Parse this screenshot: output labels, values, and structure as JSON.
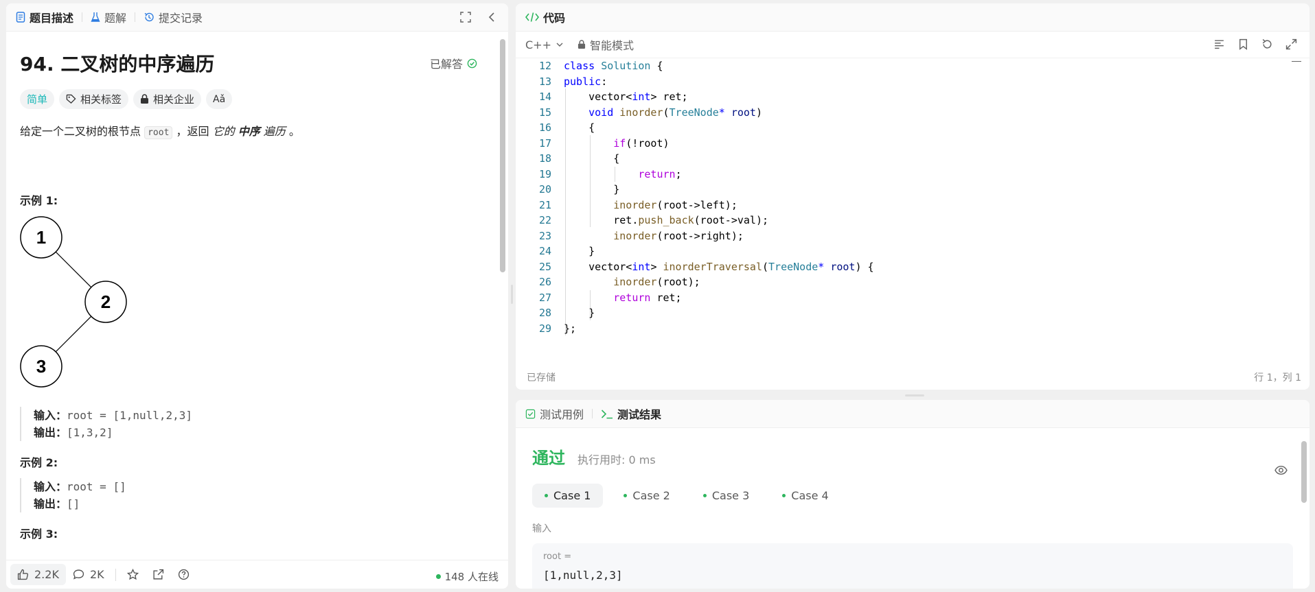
{
  "left_tabs": [
    {
      "label": "题目描述",
      "icon": "document-icon",
      "active": true
    },
    {
      "label": "题解",
      "icon": "flask-icon",
      "active": false
    },
    {
      "label": "提交记录",
      "icon": "history-icon",
      "active": false
    }
  ],
  "problem": {
    "title": "94. 二叉树的中序遍历",
    "status": "已解答",
    "difficulty": "简单",
    "chips": [
      "相关标签",
      "相关企业"
    ],
    "translate_label": "Aǎ",
    "desc_prefix": "给定一个二叉树的根节点 ",
    "desc_code": "root",
    "desc_middle": " ，返回 ",
    "desc_it1": "它的 ",
    "desc_bold": "中序",
    "desc_it2": " 遍历",
    "desc_suffix": " 。",
    "tree_nodes": [
      "1",
      "2",
      "3"
    ],
    "examples": [
      {
        "heading": "示例 1:",
        "input_label": "输入：",
        "input": "root = [1,null,2,3]",
        "output_label": "输出：",
        "output": "[1,3,2]"
      },
      {
        "heading": "示例 2:",
        "input_label": "输入：",
        "input": "root = []",
        "output_label": "输出：",
        "output": "[]"
      },
      {
        "heading": "示例 3:"
      }
    ]
  },
  "footer": {
    "likes": "2.2K",
    "comments": "2K",
    "online": "148 人在线"
  },
  "code_panel": {
    "title": "代码",
    "language": "C++",
    "mode": "智能模式",
    "status_left": "已存储",
    "status_right": "行 1，列 1",
    "lines": [
      {
        "n": "12",
        "html": "<span class='k'>class</span> <span class='t'>Solution</span> {"
      },
      {
        "n": "13",
        "html": "<span class='k'>public</span>:"
      },
      {
        "n": "14",
        "html": "    vector&lt;<span class='k'>int</span>&gt; ret;"
      },
      {
        "n": "15",
        "html": "    <span class='k'>void</span> <span class='f'>inorder</span>(<span class='t'>TreeNode</span><span class='k'>*</span> <span class='v'>root</span>)"
      },
      {
        "n": "16",
        "html": "    {"
      },
      {
        "n": "17",
        "html": "        <span class='c'>if</span>(!root)"
      },
      {
        "n": "18",
        "html": "        {"
      },
      {
        "n": "19",
        "html": "            <span class='c'>return</span>;"
      },
      {
        "n": "20",
        "html": "        }"
      },
      {
        "n": "21",
        "html": "        <span class='f'>inorder</span>(root-&gt;left);"
      },
      {
        "n": "22",
        "html": "        ret.<span class='f'>push_back</span>(root-&gt;val);"
      },
      {
        "n": "23",
        "html": "        <span class='f'>inorder</span>(root-&gt;right);"
      },
      {
        "n": "24",
        "html": "    }"
      },
      {
        "n": "25",
        "html": "    vector&lt;<span class='k'>int</span>&gt; <span class='f'>inorderTraversal</span>(<span class='t'>TreeNode</span><span class='k'>*</span> <span class='v'>root</span>) {"
      },
      {
        "n": "26",
        "html": "        <span class='f'>inorder</span>(root);"
      },
      {
        "n": "27",
        "html": "        <span class='c'>return</span> ret;"
      },
      {
        "n": "28",
        "html": "    }"
      },
      {
        "n": "29",
        "html": "};"
      }
    ]
  },
  "result_panel": {
    "tabs": [
      {
        "label": "测试用例",
        "icon": "checkbox-icon",
        "active": false
      },
      {
        "label": "测试结果",
        "icon": "terminal-icon",
        "active": true
      }
    ],
    "verdict": "通过",
    "runtime": "执行用时: 0 ms",
    "cases": [
      "Case 1",
      "Case 2",
      "Case 3",
      "Case 4"
    ],
    "input_label": "输入",
    "var_name": "root =",
    "var_value": "[1,null,2,3]"
  },
  "colors": {
    "accent_green": "#2db55d",
    "easy": "#1cb8b8"
  }
}
